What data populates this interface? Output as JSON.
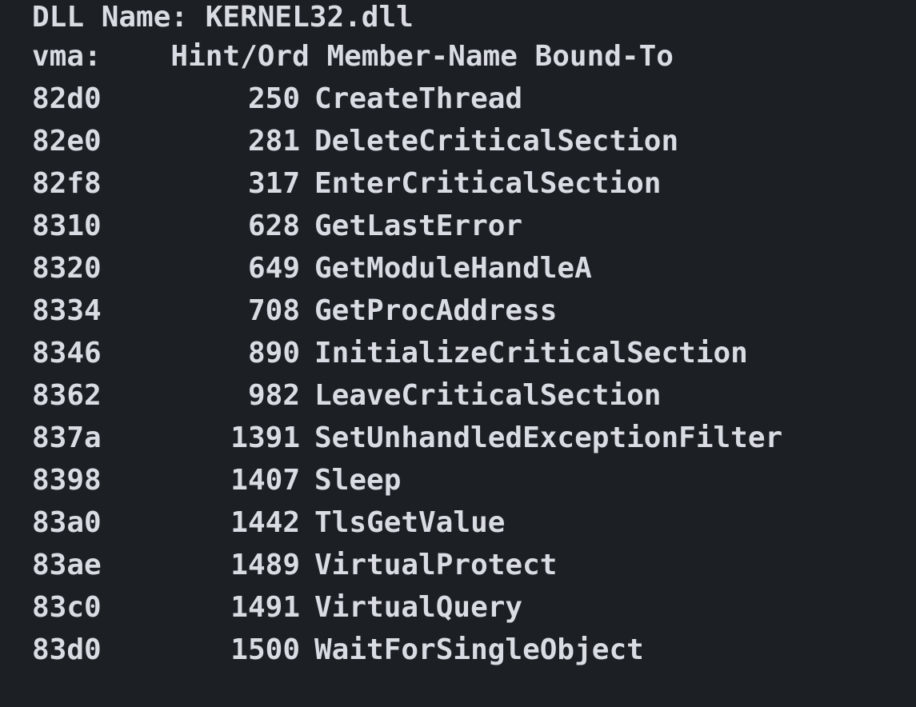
{
  "dll_header": "DLL Name: KERNEL32.dll",
  "column_header": "vma:    Hint/Ord Member-Name Bound-To",
  "rows": [
    {
      "vma": "82d0",
      "hint": "250",
      "name": "CreateThread"
    },
    {
      "vma": "82e0",
      "hint": "281",
      "name": "DeleteCriticalSection"
    },
    {
      "vma": "82f8",
      "hint": "317",
      "name": "EnterCriticalSection"
    },
    {
      "vma": "8310",
      "hint": "628",
      "name": "GetLastError"
    },
    {
      "vma": "8320",
      "hint": "649",
      "name": "GetModuleHandleA"
    },
    {
      "vma": "8334",
      "hint": "708",
      "name": "GetProcAddress"
    },
    {
      "vma": "8346",
      "hint": "890",
      "name": "InitializeCriticalSection"
    },
    {
      "vma": "8362",
      "hint": "982",
      "name": "LeaveCriticalSection"
    },
    {
      "vma": "837a",
      "hint": "1391",
      "name": "SetUnhandledExceptionFilter"
    },
    {
      "vma": "8398",
      "hint": "1407",
      "name": "Sleep"
    },
    {
      "vma": "83a0",
      "hint": "1442",
      "name": "TlsGetValue"
    },
    {
      "vma": "83ae",
      "hint": "1489",
      "name": "VirtualProtect"
    },
    {
      "vma": "83c0",
      "hint": "1491",
      "name": "VirtualQuery"
    },
    {
      "vma": "83d0",
      "hint": "1500",
      "name": "WaitForSingleObject"
    }
  ],
  "colors": {
    "background": "#1c1f24",
    "text": "#d9dce2"
  }
}
